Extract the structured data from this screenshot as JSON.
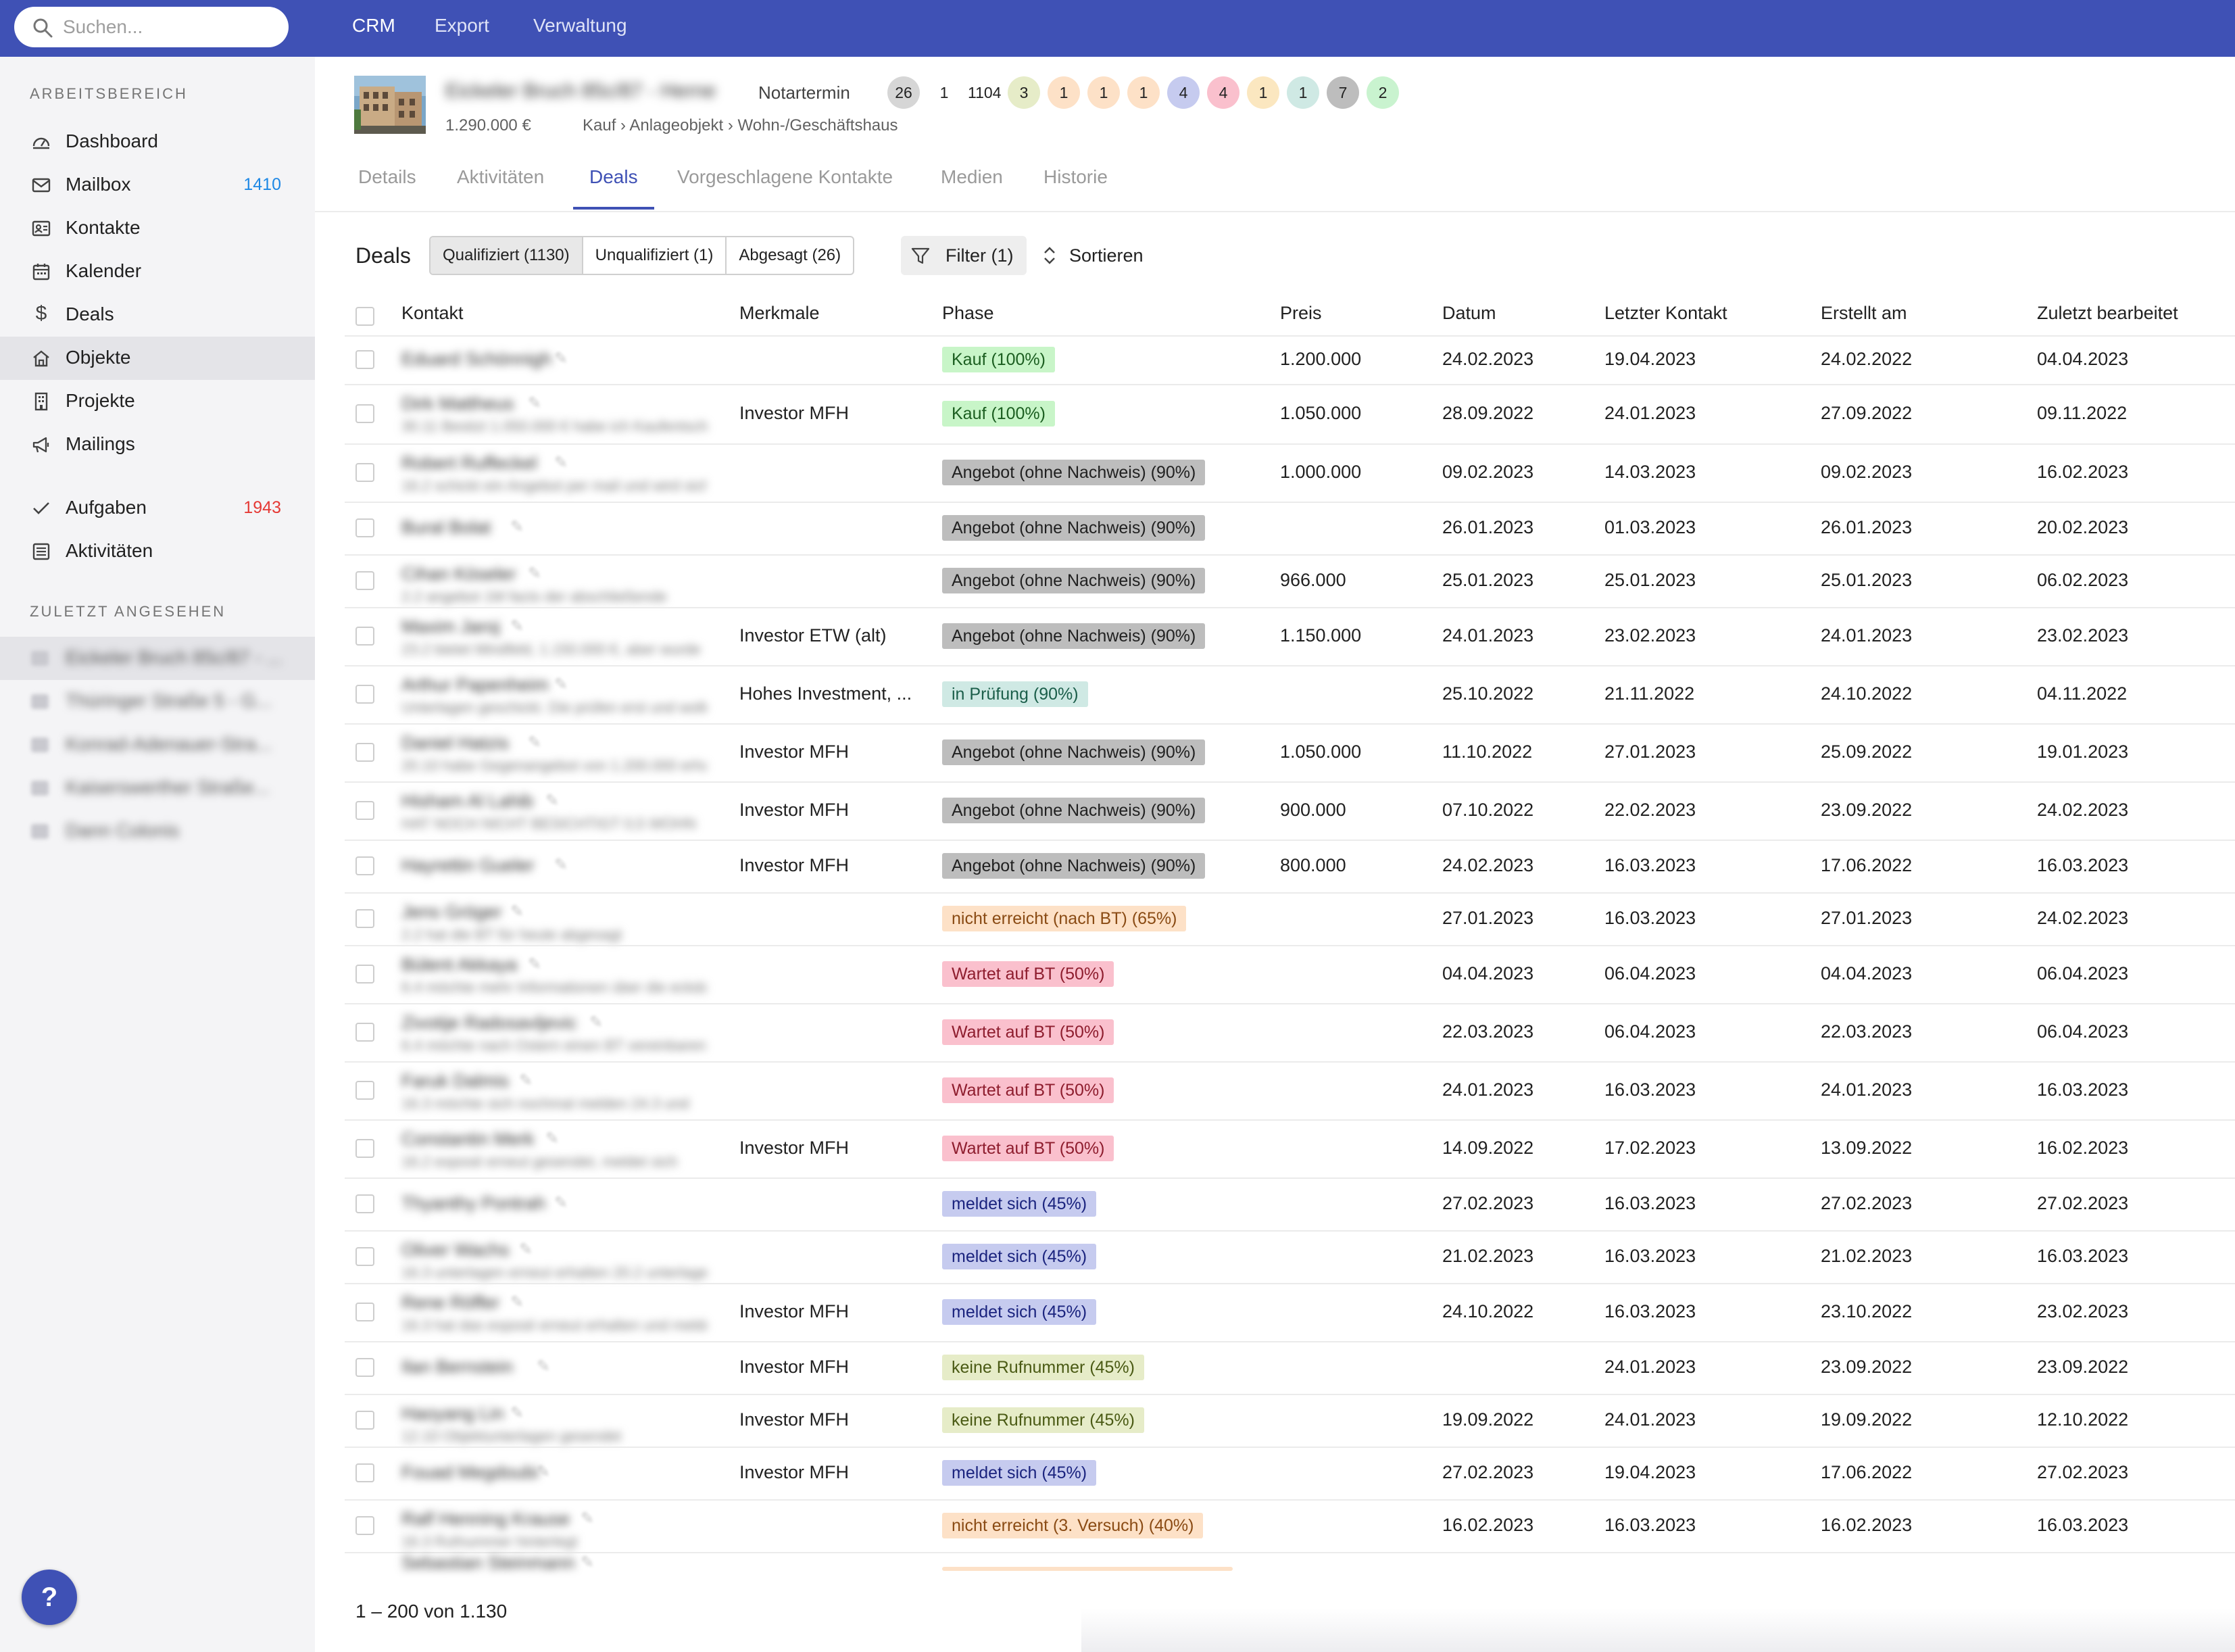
{
  "search": {
    "placeholder": "Suchen..."
  },
  "topnav": [
    {
      "label": "CRM"
    },
    {
      "label": "Export"
    },
    {
      "label": "Verwaltung"
    }
  ],
  "sidebar": {
    "workspace_heading": "ARBEITSBEREICH",
    "items": [
      {
        "label": "Dashboard",
        "icon": "dashboard-icon"
      },
      {
        "label": "Mailbox",
        "icon": "mail-icon",
        "count": "1410",
        "count_color": "#1e88e5"
      },
      {
        "label": "Kontakte",
        "icon": "contacts-icon"
      },
      {
        "label": "Kalender",
        "icon": "calendar-icon"
      },
      {
        "label": "Deals",
        "icon": "dollar-icon"
      },
      {
        "label": "Objekte",
        "icon": "home-icon",
        "active": true
      },
      {
        "label": "Projekte",
        "icon": "building-icon"
      },
      {
        "label": "Mailings",
        "icon": "megaphone-icon"
      },
      {
        "label": "Aufgaben",
        "icon": "check-icon",
        "count": "1943",
        "count_color": "#e53935"
      },
      {
        "label": "Aktivitäten",
        "icon": "list-icon"
      }
    ],
    "recent_heading": "ZULETZT ANGESEHEN",
    "recent": [
      {
        "label": "Eickeler Bruch 85c/87 - ..."
      },
      {
        "label": "Thüringer Straße 5 - G..."
      },
      {
        "label": "Konrad-Adenauer-Stra..."
      },
      {
        "label": "Kaiserswerther Straße..."
      },
      {
        "label": "Dann Colonis"
      }
    ],
    "help_label": "?"
  },
  "object": {
    "title": "Eickeler Bruch 85c/87 - Herne",
    "status": "Notartermin",
    "price": "1.290.000 €",
    "breadcrumb": "Kauf › Anlageobjekt › Wohn-/Geschäftshaus",
    "badges": [
      {
        "value": "26",
        "color": "#d6d6d6"
      },
      {
        "value": "1",
        "color": "#ffffff"
      },
      {
        "value": "1104",
        "color": "#ffffff"
      },
      {
        "value": "3",
        "color": "#e6ecc8"
      },
      {
        "value": "1",
        "color": "#fde1c7"
      },
      {
        "value": "1",
        "color": "#fde1c7"
      },
      {
        "value": "1",
        "color": "#fde1c7"
      },
      {
        "value": "4",
        "color": "#c6cbef"
      },
      {
        "value": "4",
        "color": "#fac0cd"
      },
      {
        "value": "1",
        "color": "#fbe7c0"
      },
      {
        "value": "1",
        "color": "#cfe9e4"
      },
      {
        "value": "7",
        "color": "#bdbdbd"
      },
      {
        "value": "2",
        "color": "#c9f3cf"
      }
    ]
  },
  "tabs": [
    {
      "label": "Details"
    },
    {
      "label": "Aktivitäten"
    },
    {
      "label": "Deals",
      "active": true
    },
    {
      "label": "Vorgeschlagene Kontakte"
    },
    {
      "label": "Medien"
    },
    {
      "label": "Historie"
    }
  ],
  "toolbar": {
    "title": "Deals",
    "segments": [
      {
        "label": "Qualifiziert (1130)",
        "active": true
      },
      {
        "label": "Unqualifiziert (1)"
      },
      {
        "label": "Abgesagt (26)"
      }
    ],
    "filter_label": "Filter (1)",
    "sort_label": "Sortieren"
  },
  "table": {
    "columns": [
      "Kontakt",
      "Merkmale",
      "Phase",
      "Preis",
      "Datum",
      "Letzter Kontakt",
      "Erstellt am",
      "Zuletzt bearbeitet"
    ],
    "rows": [
      {
        "name": "Eduard Schönnigh",
        "sub": "",
        "merkmale": "",
        "phase": "Kauf (100%)",
        "phase_bg": "#c8f5c8",
        "phase_fg": "#1b5e20",
        "preis": "1.200.000",
        "datum": "24.02.2023",
        "letzter": "19.04.2023",
        "erstellt": "24.02.2022",
        "bearbeitet": "04.04.2023"
      },
      {
        "name": "Dirk Mattheus",
        "sub": "30.11 Besitzt 1.050.000 € habe ich Kaufentscheidung",
        "merkmale": "Investor MFH",
        "phase": "Kauf (100%)",
        "phase_bg": "#c8f5c8",
        "phase_fg": "#1b5e20",
        "preis": "1.050.000",
        "datum": "28.09.2022",
        "letzter": "24.01.2023",
        "erstellt": "27.09.2022",
        "bearbeitet": "09.11.2022"
      },
      {
        "name": "Robert Ruffeckel",
        "sub": "16.2 schickt ein Angebot per mail und wird sich melden",
        "merkmale": "",
        "phase": "Angebot (ohne Nachweis) (90%)",
        "phase_bg": "#bdbdbd",
        "phase_fg": "#212121",
        "preis": "1.000.000",
        "datum": "09.02.2023",
        "letzter": "14.03.2023",
        "erstellt": "09.02.2023",
        "bearbeitet": "16.02.2023"
      },
      {
        "name": "Bural Bolat",
        "sub": "",
        "merkmale": "",
        "phase": "Angebot (ohne Nachweis) (90%)",
        "phase_bg": "#bdbdbd",
        "phase_fg": "#212121",
        "preis": "",
        "datum": "26.01.2023",
        "letzter": "01.03.2023",
        "erstellt": "26.01.2023",
        "bearbeitet": "20.02.2023"
      },
      {
        "name": "Cihan Köseler",
        "sub": "2.2 angebot 1M facts der abschließende",
        "merkmale": "",
        "phase": "Angebot (ohne Nachweis) (90%)",
        "phase_bg": "#bdbdbd",
        "phase_fg": "#212121",
        "preis": "966.000",
        "datum": "25.01.2023",
        "letzter": "25.01.2023",
        "erstellt": "25.01.2023",
        "bearbeitet": "06.02.2023"
      },
      {
        "name": "Maxim Jaroj",
        "sub": "23.2 bietet Mindfeld, 1.150.000 €, aber wurde",
        "merkmale": "Investor ETW (alt)",
        "phase": "Angebot (ohne Nachweis) (90%)",
        "phase_bg": "#bdbdbd",
        "phase_fg": "#212121",
        "preis": "1.150.000",
        "datum": "24.01.2023",
        "letzter": "23.02.2023",
        "erstellt": "24.01.2023",
        "bearbeitet": "23.02.2023"
      },
      {
        "name": "Arthur Papenheim",
        "sub": "Unterlagen geschickt. Die prüfen erst und wollen",
        "merkmale": "Hohes Investment, ...",
        "phase": "in Prüfung (90%)",
        "phase_bg": "#cfe9e4",
        "phase_fg": "#1b5e4a",
        "preis": "",
        "datum": "25.10.2022",
        "letzter": "21.11.2022",
        "erstellt": "24.10.2022",
        "bearbeitet": "04.11.2022"
      },
      {
        "name": "Daniel Hatzis",
        "sub": "20.10 habe Gegenangebot von 1.200.000 erhalten",
        "merkmale": "Investor MFH",
        "phase": "Angebot (ohne Nachweis) (90%)",
        "phase_bg": "#bdbdbd",
        "phase_fg": "#212121",
        "preis": "1.050.000",
        "datum": "11.10.2022",
        "letzter": "27.01.2023",
        "erstellt": "25.09.2022",
        "bearbeitet": "19.01.2023"
      },
      {
        "name": "Hisham Al Lahib",
        "sub": "HAT NOCH NICHT BESICHTIGT 0,5 WOHN",
        "merkmale": "Investor MFH",
        "phase": "Angebot (ohne Nachweis) (90%)",
        "phase_bg": "#bdbdbd",
        "phase_fg": "#212121",
        "preis": "900.000",
        "datum": "07.10.2022",
        "letzter": "22.02.2023",
        "erstellt": "23.09.2022",
        "bearbeitet": "24.02.2023"
      },
      {
        "name": "Hayrettin Gueler",
        "sub": "",
        "merkmale": "Investor MFH",
        "phase": "Angebot (ohne Nachweis) (90%)",
        "phase_bg": "#bdbdbd",
        "phase_fg": "#212121",
        "preis": "800.000",
        "datum": "24.02.2023",
        "letzter": "16.03.2023",
        "erstellt": "17.06.2022",
        "bearbeitet": "16.03.2023"
      },
      {
        "name": "Jens Gröger",
        "sub": "2.2 hat die BT für heute abgesagt",
        "merkmale": "",
        "phase": "nicht erreicht (nach BT) (65%)",
        "phase_bg": "#fde1c7",
        "phase_fg": "#8a4b14",
        "preis": "",
        "datum": "27.01.2023",
        "letzter": "16.03.2023",
        "erstellt": "27.01.2023",
        "bearbeitet": "24.02.2023"
      },
      {
        "name": "Bülent Akkaya",
        "sub": "6.4 möchte mehr Informationen über die eckdaten",
        "merkmale": "",
        "phase": "Wartet auf BT (50%)",
        "phase_bg": "#fac0cd",
        "phase_fg": "#8e1d2e",
        "preis": "",
        "datum": "04.04.2023",
        "letzter": "06.04.2023",
        "erstellt": "04.04.2023",
        "bearbeitet": "06.04.2023"
      },
      {
        "name": "Zivotije Radosavljevic",
        "sub": "6.4 möchte nach Ostern einen BT vereinbaren",
        "merkmale": "",
        "phase": "Wartet auf BT (50%)",
        "phase_bg": "#fac0cd",
        "phase_fg": "#8e1d2e",
        "preis": "",
        "datum": "22.03.2023",
        "letzter": "06.04.2023",
        "erstellt": "22.03.2023",
        "bearbeitet": "06.04.2023"
      },
      {
        "name": "Faruk Dalmis",
        "sub": "16.3 möchte sich nochmal melden 24.3 und",
        "merkmale": "",
        "phase": "Wartet auf BT (50%)",
        "phase_bg": "#fac0cd",
        "phase_fg": "#8e1d2e",
        "preis": "",
        "datum": "24.01.2023",
        "letzter": "16.03.2023",
        "erstellt": "24.01.2023",
        "bearbeitet": "16.03.2023"
      },
      {
        "name": "Constantin Merk",
        "sub": "16.2 exposé erneut gesendet, meldet sich",
        "merkmale": "Investor MFH",
        "phase": "Wartet auf BT (50%)",
        "phase_bg": "#fac0cd",
        "phase_fg": "#8e1d2e",
        "preis": "",
        "datum": "14.09.2022",
        "letzter": "17.02.2023",
        "erstellt": "13.09.2022",
        "bearbeitet": "16.02.2023"
      },
      {
        "name": "Thyanthy Pontrah",
        "sub": "",
        "merkmale": "",
        "phase": "meldet sich (45%)",
        "phase_bg": "#c6cbef",
        "phase_fg": "#1a237e",
        "preis": "",
        "datum": "27.02.2023",
        "letzter": "16.03.2023",
        "erstellt": "27.02.2023",
        "bearbeitet": "27.02.2023"
      },
      {
        "name": "Oliver Wachs",
        "sub": "16.3 unterlagen erneut erhalten 20.2 unterlagen",
        "merkmale": "",
        "phase": "meldet sich (45%)",
        "phase_bg": "#c6cbef",
        "phase_fg": "#1a237e",
        "preis": "",
        "datum": "21.02.2023",
        "letzter": "16.03.2023",
        "erstellt": "21.02.2023",
        "bearbeitet": "16.03.2023"
      },
      {
        "name": "Rene Röffer",
        "sub": "16.3 hat das exposé erneut erhalten und meldet",
        "merkmale": "Investor MFH",
        "phase": "meldet sich (45%)",
        "phase_bg": "#c6cbef",
        "phase_fg": "#1a237e",
        "preis": "",
        "datum": "24.10.2022",
        "letzter": "16.03.2023",
        "erstellt": "23.10.2022",
        "bearbeitet": "23.02.2023"
      },
      {
        "name": "Ilan Bernstein",
        "sub": "",
        "merkmale": "Investor MFH",
        "phase": "keine Rufnummer (45%)",
        "phase_bg": "#e6ecc8",
        "phase_fg": "#4a5a14",
        "preis": "",
        "datum": "",
        "letzter": "24.01.2023",
        "erstellt": "23.09.2022",
        "bearbeitet": "23.09.2022"
      },
      {
        "name": "Haoyang Lin",
        "sub": "12.10 Objektunterlagen gesendet",
        "merkmale": "Investor MFH",
        "phase": "keine Rufnummer (45%)",
        "phase_bg": "#e6ecc8",
        "phase_fg": "#4a5a14",
        "preis": "",
        "datum": "19.09.2022",
        "letzter": "24.01.2023",
        "erstellt": "19.09.2022",
        "bearbeitet": "12.10.2022"
      },
      {
        "name": "Fouad Megdoubi",
        "sub": "",
        "merkmale": "Investor MFH",
        "phase": "meldet sich (45%)",
        "phase_bg": "#c6cbef",
        "phase_fg": "#1a237e",
        "preis": "",
        "datum": "27.02.2023",
        "letzter": "19.04.2023",
        "erstellt": "17.06.2022",
        "bearbeitet": "27.02.2023"
      },
      {
        "name": "Ralf Henning Krause",
        "sub": "16.3 Rufnummer hinterlegt",
        "merkmale": "",
        "phase": "nicht erreicht (3. Versuch) (40%)",
        "phase_bg": "#fde1c7",
        "phase_fg": "#8a4b14",
        "preis": "",
        "datum": "16.02.2023",
        "letzter": "16.03.2023",
        "erstellt": "16.02.2023",
        "bearbeitet": "16.03.2023"
      },
      {
        "name": "Sebastian Steinmann",
        "sub": "",
        "merkmale": "",
        "phase": "",
        "phase_bg": "#fde1c7",
        "phase_fg": "#8a4b14",
        "preis": "",
        "datum": "",
        "letzter": "",
        "erstellt": "",
        "bearbeitet": ""
      }
    ]
  },
  "pager": {
    "label": "1 – 200 von 1.130"
  }
}
